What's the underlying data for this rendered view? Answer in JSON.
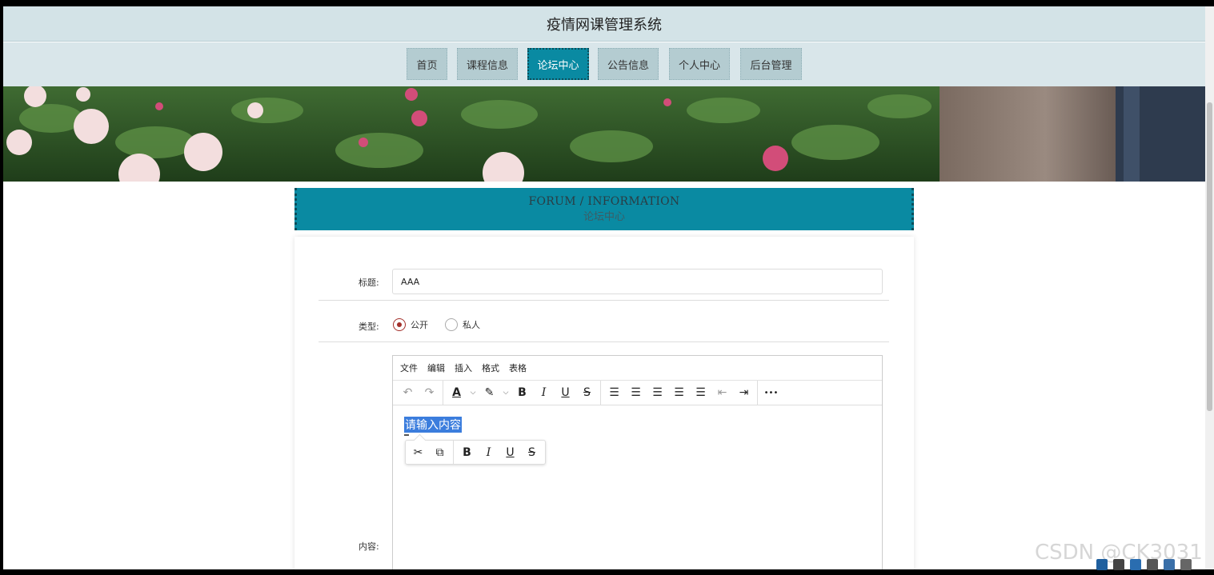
{
  "app": {
    "title": "疫情网课管理系统"
  },
  "nav": {
    "items": [
      {
        "label": "首页"
      },
      {
        "label": "课程信息"
      },
      {
        "label": "论坛中心"
      },
      {
        "label": "公告信息"
      },
      {
        "label": "个人中心"
      },
      {
        "label": "后台管理"
      }
    ],
    "active_index": 2
  },
  "section": {
    "title_en": "FORUM / INFORMATION",
    "title_cn": "论坛中心"
  },
  "form": {
    "title_label": "标题:",
    "title_value": "AAA",
    "type_label": "类型:",
    "type_options": [
      {
        "label": "公开",
        "checked": true
      },
      {
        "label": "私人",
        "checked": false
      }
    ],
    "content_label": "内容:"
  },
  "editor": {
    "menus": [
      "文件",
      "编辑",
      "插入",
      "格式",
      "表格"
    ],
    "toolbar_icons": [
      "undo-icon",
      "redo-icon",
      "text-color-icon",
      "highlight-icon",
      "bold-icon",
      "italic-icon",
      "underline-icon",
      "strikethrough-icon",
      "line-height-icon",
      "align-left-icon",
      "align-center-icon",
      "align-right-icon",
      "align-justify-icon",
      "outdent-icon",
      "indent-icon",
      "more-icon"
    ],
    "toolbar_glyphs": {
      "undo": "↶",
      "redo": "↷",
      "text_color": "A",
      "highlight": "✎",
      "caret": "⌵",
      "bold": "B",
      "italic": "I",
      "underline": "U",
      "strike": "S",
      "line_height": "☰",
      "align_left": "☰",
      "align_center": "☰",
      "align_right": "☰",
      "justify": "☰",
      "outdent": "⇤",
      "indent": "⇥",
      "more": "•••",
      "cut": "✂",
      "copy": "⧉"
    },
    "placeholder_selected": "请输入内容"
  },
  "watermark": "CSDN @CK3031",
  "colors": {
    "accent": "#0a8aa2",
    "nav_bg": "#d9e6ea",
    "radio_checked": "#a3302b"
  }
}
